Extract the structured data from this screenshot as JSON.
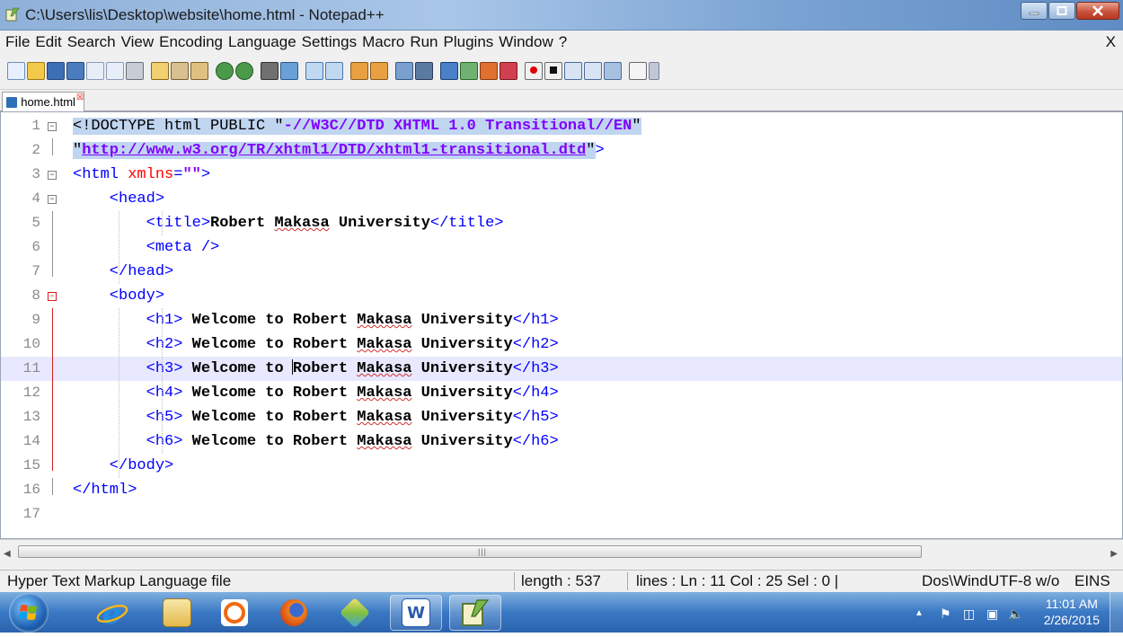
{
  "window": {
    "title": "C:\\Users\\lis\\Desktop\\website\\home.html - Notepad++"
  },
  "menu": {
    "items": [
      "File",
      "Edit",
      "Search",
      "View",
      "Encoding",
      "Language",
      "Settings",
      "Macro",
      "Run",
      "Plugins",
      "Window",
      "?"
    ],
    "close": "X"
  },
  "tab": {
    "label": "home.html"
  },
  "editor": {
    "line_numbers": [
      "1",
      "2",
      "3",
      "4",
      "5",
      "6",
      "7",
      "8",
      "9",
      "10",
      "11",
      "12",
      "13",
      "14",
      "15",
      "16",
      "17"
    ],
    "lines": [
      [
        {
          "t": "<!DOCTYPE html PUBLIC \"",
          "c": "sel"
        },
        {
          "t": "-//W3C//DTD XHTML 1.0 Transitional//EN",
          "c": "sel str"
        },
        {
          "t": "\"",
          "c": "sel"
        }
      ],
      [
        {
          "t": "\"",
          "c": "sel"
        },
        {
          "t": "http://www.w3.org/TR/xhtml1/DTD/xhtml1-transitional.dtd",
          "c": "sel url"
        },
        {
          "t": "\"",
          "c": "sel"
        },
        {
          "t": ">",
          "c": "tg"
        }
      ],
      [
        {
          "t": "<html ",
          "c": "tg"
        },
        {
          "t": "xmlns",
          "c": "at"
        },
        {
          "t": "=",
          "c": "tg"
        },
        {
          "t": "\"\"",
          "c": "str"
        },
        {
          "t": ">",
          "c": "tg"
        }
      ],
      [
        {
          "t": "    <head>",
          "c": "tg"
        }
      ],
      [
        {
          "t": "        <title>",
          "c": "tg"
        },
        {
          "t": "Robert ",
          "c": "bt"
        },
        {
          "t": "Makasa",
          "c": "bt sq"
        },
        {
          "t": " University",
          "c": "bt"
        },
        {
          "t": "</title>",
          "c": "tg"
        }
      ],
      [
        {
          "t": "        <meta />",
          "c": "tg"
        }
      ],
      [
        {
          "t": "    </head>",
          "c": "tg"
        }
      ],
      [
        {
          "t": "    <body>",
          "c": "tg"
        }
      ],
      [
        {
          "t": "        <h1>",
          "c": "tg"
        },
        {
          "t": " Welcome to Robert ",
          "c": "bt"
        },
        {
          "t": "Makasa",
          "c": "bt sq"
        },
        {
          "t": " University",
          "c": "bt"
        },
        {
          "t": "</h1>",
          "c": "tg"
        }
      ],
      [
        {
          "t": "        <h2>",
          "c": "tg"
        },
        {
          "t": " Welcome to Robert ",
          "c": "bt"
        },
        {
          "t": "Makasa",
          "c": "bt sq"
        },
        {
          "t": " University",
          "c": "bt"
        },
        {
          "t": "</h2>",
          "c": "tg"
        }
      ],
      [
        {
          "t": "        <h3>",
          "c": "tg"
        },
        {
          "t": " Welcome to ",
          "c": "bt"
        },
        {
          "t": "",
          "c": "caret"
        },
        {
          "t": "Robert ",
          "c": "bt"
        },
        {
          "t": "Makasa",
          "c": "bt sq"
        },
        {
          "t": " University",
          "c": "bt"
        },
        {
          "t": "</h3>",
          "c": "tg"
        }
      ],
      [
        {
          "t": "        <h4>",
          "c": "tg"
        },
        {
          "t": " Welcome to Robert ",
          "c": "bt"
        },
        {
          "t": "Makasa",
          "c": "bt sq"
        },
        {
          "t": " University",
          "c": "bt"
        },
        {
          "t": "</h4>",
          "c": "tg"
        }
      ],
      [
        {
          "t": "        <h5>",
          "c": "tg"
        },
        {
          "t": " Welcome to Robert ",
          "c": "bt"
        },
        {
          "t": "Makasa",
          "c": "bt sq"
        },
        {
          "t": " University",
          "c": "bt"
        },
        {
          "t": "</h5>",
          "c": "tg"
        }
      ],
      [
        {
          "t": "        <h6>",
          "c": "tg"
        },
        {
          "t": " Welcome to Robert ",
          "c": "bt"
        },
        {
          "t": "Makasa",
          "c": "bt sq"
        },
        {
          "t": " University",
          "c": "bt"
        },
        {
          "t": "</h6>",
          "c": "tg"
        }
      ],
      [
        {
          "t": "    </body>",
          "c": "tg"
        }
      ],
      [
        {
          "t": "</html>",
          "c": "tg"
        }
      ],
      []
    ],
    "current_line": 11
  },
  "status": {
    "filetype": "Hyper Text Markup Language file",
    "length": "length : 537",
    "position": "lines : Ln : 11    Col : 25    Sel : 0 |",
    "eol": "Dos\\Windc",
    "encoding": "UTF-8 w/o",
    "mode": "EINS"
  },
  "clock": {
    "time": "11:01 AM",
    "date": "2/26/2015"
  },
  "colors": {
    "tag": "#0000ff",
    "attr": "#ff0000",
    "string": "#8000ff",
    "selection": "#c0d5f0",
    "current_line": "#e8e8ff"
  }
}
